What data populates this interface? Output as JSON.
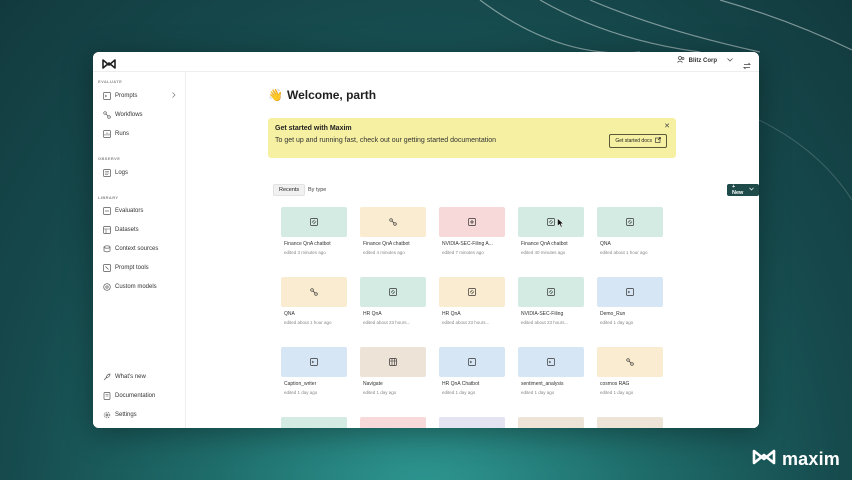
{
  "brand": {
    "name": "maxim"
  },
  "topbar": {
    "org_name": "Blitz Corp"
  },
  "sidebar": {
    "sections": [
      {
        "title": "EVALUATE",
        "items": [
          {
            "label": "Prompts",
            "icon": "prompt-icon"
          },
          {
            "label": "Workflows",
            "icon": "workflow-icon"
          },
          {
            "label": "Runs",
            "icon": "runs-icon"
          }
        ]
      },
      {
        "title": "OBSERVE",
        "items": [
          {
            "label": "Logs",
            "icon": "logs-icon"
          }
        ]
      },
      {
        "title": "LIBRARY",
        "items": [
          {
            "label": "Evaluators",
            "icon": "evaluators-icon"
          },
          {
            "label": "Datasets",
            "icon": "datasets-icon"
          },
          {
            "label": "Context sources",
            "icon": "database-icon"
          },
          {
            "label": "Prompt tools",
            "icon": "tools-icon"
          },
          {
            "label": "Custom models",
            "icon": "models-icon"
          }
        ]
      }
    ],
    "bottom": [
      {
        "label": "What's new",
        "icon": "rocket-icon"
      },
      {
        "label": "Documentation",
        "icon": "doc-icon"
      },
      {
        "label": "Settings",
        "icon": "gear-icon"
      }
    ]
  },
  "main": {
    "welcome": "Welcome, parth",
    "welcome_emoji": "👋",
    "banner": {
      "title": "Get started with Maxim",
      "text": "To get up and running fast, check out our getting started documentation",
      "button": "Get started docs"
    },
    "tabs": [
      "Recents",
      "By type"
    ],
    "new_button": "+ New",
    "cards": [
      {
        "title": "Finance QnA chatbot",
        "sub": "edited 3 minutes ago",
        "color": "#d4ebe3",
        "icon": "prompt-icon"
      },
      {
        "title": "Finance QnA chatbot",
        "sub": "edited 4 minutes ago",
        "color": "#f9ecd0",
        "icon": "workflow-icon"
      },
      {
        "title": "NVIDIA-SEC-Filing A...",
        "sub": "edited 7 minutes ago",
        "color": "#f8d9d9",
        "icon": "prompt-chain-icon"
      },
      {
        "title": "Finance QnA chatbot",
        "sub": "edited 40 minutes ago",
        "color": "#d4ebe3",
        "icon": "prompt-icon"
      },
      {
        "title": "QNA",
        "sub": "edited about 1 hour ago",
        "color": "#d4ebe3",
        "icon": "prompt-icon"
      },
      {
        "title": "QNA",
        "sub": "edited about 1 hour ago",
        "color": "#f9ecd0",
        "icon": "workflow-icon"
      },
      {
        "title": "HR QnA",
        "sub": "edited about 23 hours...",
        "color": "#d4ebe3",
        "icon": "prompt-icon"
      },
      {
        "title": "HR QnA",
        "sub": "edited about 23 hours...",
        "color": "#f9ecd0",
        "icon": "prompt-icon"
      },
      {
        "title": "NVIDIA-SEC-Filing",
        "sub": "edited about 23 hours...",
        "color": "#d4ebe3",
        "icon": "prompt-icon"
      },
      {
        "title": "Demo_Run",
        "sub": "edited 1 day ago",
        "color": "#d6e6f4",
        "icon": "terminal-icon"
      },
      {
        "title": "Caption_writer",
        "sub": "edited 1 day ago",
        "color": "#d6e6f4",
        "icon": "terminal-icon"
      },
      {
        "title": "Navigate",
        "sub": "edited 1 day ago",
        "color": "#ede3d6",
        "icon": "table-icon"
      },
      {
        "title": "HR QnA Chatbot",
        "sub": "edited 1 day ago",
        "color": "#d6e6f4",
        "icon": "terminal-icon"
      },
      {
        "title": "sentiment_analysis",
        "sub": "edited 1 day ago",
        "color": "#d6e6f4",
        "icon": "terminal-icon"
      },
      {
        "title": "cosmos RAG",
        "sub": "edited 1 day ago",
        "color": "#f9ecd0",
        "icon": "workflow-icon"
      }
    ],
    "partial_row_colors": [
      "#d4ebe3",
      "#f8d9d9",
      "#e4e3f1",
      "#ede3d6",
      "#ede3d6"
    ]
  }
}
